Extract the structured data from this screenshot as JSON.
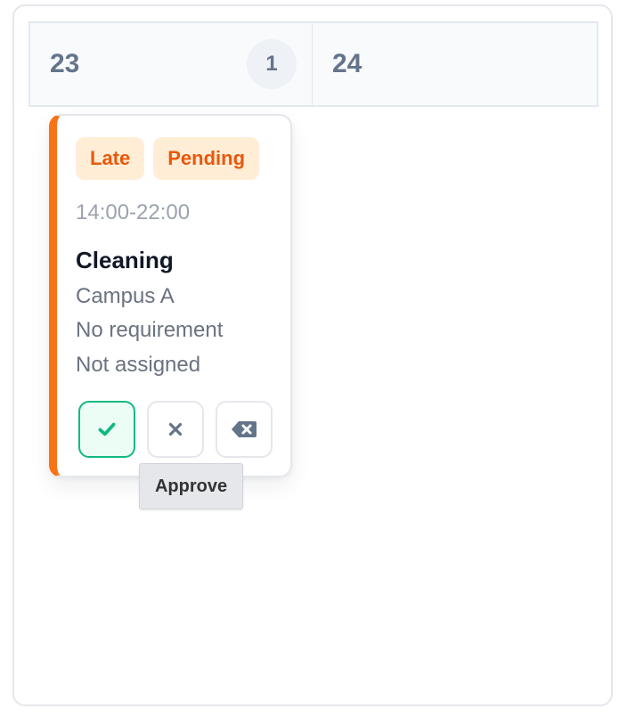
{
  "calendar": {
    "days": [
      {
        "number": "23",
        "count": "1"
      },
      {
        "number": "24"
      }
    ]
  },
  "shift": {
    "badges": [
      "Late",
      "Pending"
    ],
    "time": "14:00-22:00",
    "title": "Cleaning",
    "location": "Campus A",
    "requirement": "No requirement",
    "assignee": "Not assigned",
    "accent_color": "#f97316",
    "actions": {
      "approve_icon": "check-icon",
      "reject_icon": "x-icon",
      "delete_icon": "backspace-icon"
    }
  },
  "tooltip": {
    "text": "Approve"
  }
}
